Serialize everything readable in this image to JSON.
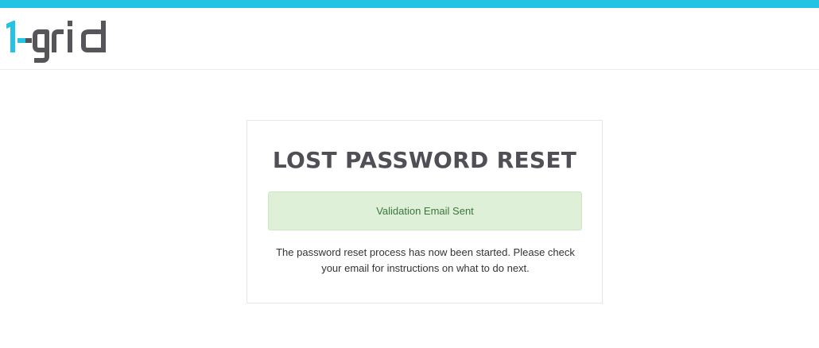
{
  "header": {
    "logo": {
      "text_prefix": "1",
      "text_suffix": "-grid",
      "accent_color": "#22c3e3",
      "text_color": "#55555a"
    },
    "top_strip_color": "#22c3e3"
  },
  "card": {
    "title": "LOST PASSWORD RESET",
    "alert": {
      "text": "Validation Email Sent",
      "status": "success",
      "background": "#dff0d8"
    },
    "message": "The password reset process has now been started. Please check your email for instructions on what to do next."
  }
}
